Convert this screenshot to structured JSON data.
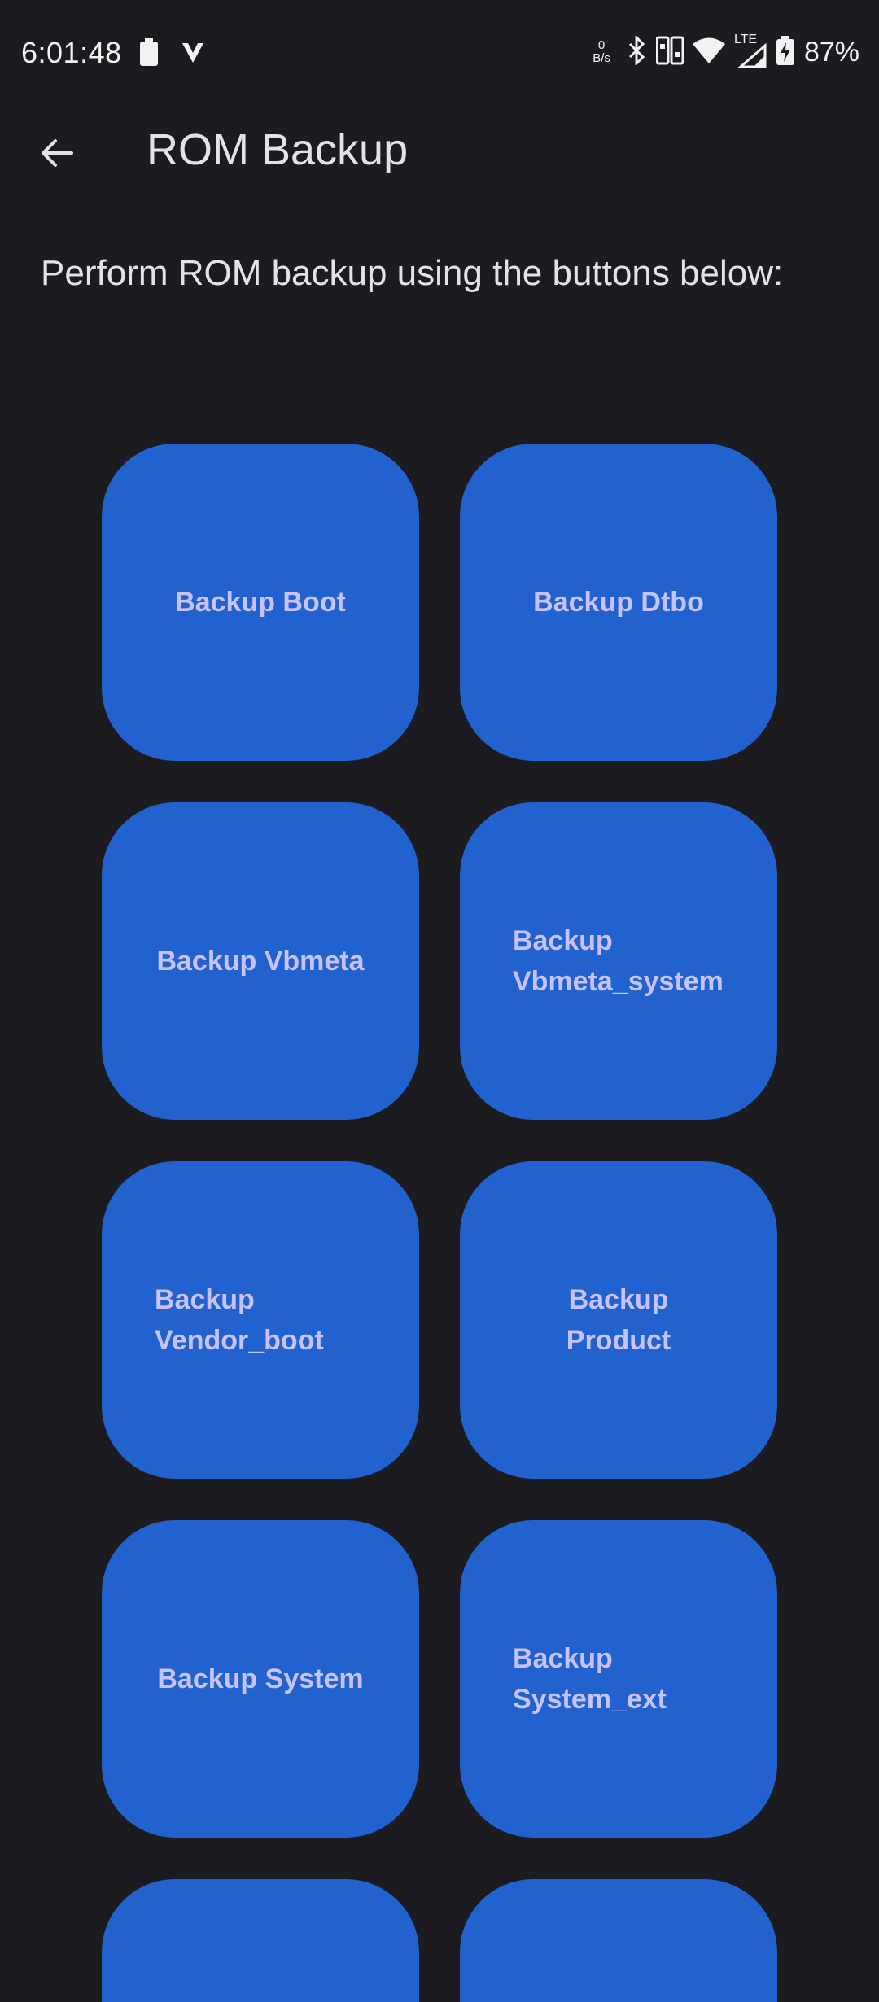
{
  "status_bar": {
    "time": "6:01:48",
    "net_speed_value": "0",
    "net_speed_unit": "B/s",
    "network_type": "LTE",
    "battery_percent": "87%",
    "icons": [
      "battery-saver-icon",
      "vivaldi-icon",
      "bluetooth-icon",
      "sim-icon",
      "wifi-icon",
      "signal-icon",
      "battery-charging-icon"
    ]
  },
  "app_bar": {
    "title": "ROM Backup",
    "back_icon": "arrow-back-icon"
  },
  "main": {
    "subtitle": "Perform ROM backup using the buttons below:",
    "buttons": [
      {
        "label": "Backup Boot"
      },
      {
        "label": "Backup Dtbo"
      },
      {
        "label": "Backup Vbmeta"
      },
      {
        "label": "Backup Vbmeta_system"
      },
      {
        "label": "Backup Vendor_boot"
      },
      {
        "label": "Backup Product"
      },
      {
        "label": "Backup System"
      },
      {
        "label": "Backup System_ext"
      },
      {
        "label": ""
      },
      {
        "label": ""
      }
    ]
  },
  "colors": {
    "background": "#1c1b1f",
    "tile": "#2262cf",
    "tile_text": "#c8c3ff",
    "text": "#e6e1e5"
  }
}
